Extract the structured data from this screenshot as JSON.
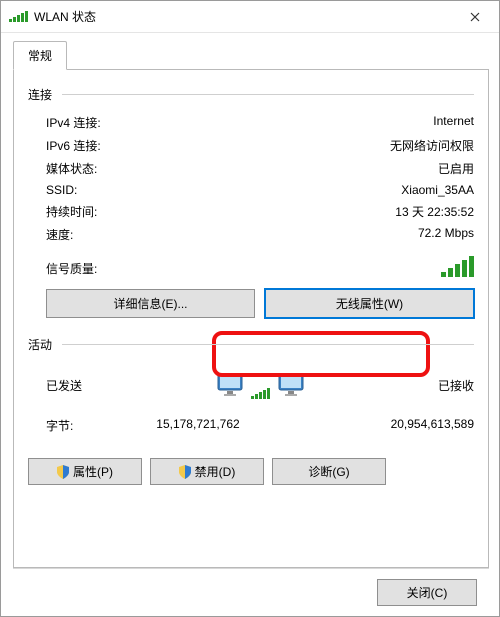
{
  "window": {
    "title": "WLAN 状态"
  },
  "tabs": {
    "general": "常规"
  },
  "connection": {
    "label": "连接",
    "ipv4_k": "IPv4 连接:",
    "ipv4_v": "Internet",
    "ipv6_k": "IPv6 连接:",
    "ipv6_v": "无网络访问权限",
    "media_k": "媒体状态:",
    "media_v": "已启用",
    "ssid_k": "SSID:",
    "ssid_v": "Xiaomi_35AA",
    "duration_k": "持续时间:",
    "duration_v": "13 天 22:35:52",
    "speed_k": "速度:",
    "speed_v": "72.2 Mbps",
    "signal_k": "信号质量:"
  },
  "buttons": {
    "details": "详细信息(E)...",
    "wireless_props": "无线属性(W)",
    "properties": "属性(P)",
    "disable": "禁用(D)",
    "diagnose": "诊断(G)",
    "close": "关闭(C)"
  },
  "activity": {
    "label": "活动",
    "sent": "已发送",
    "received": "已接收",
    "bytes_label": "字节:",
    "bytes_sent": "15,178,721,762",
    "bytes_recv": "20,954,613,589"
  }
}
